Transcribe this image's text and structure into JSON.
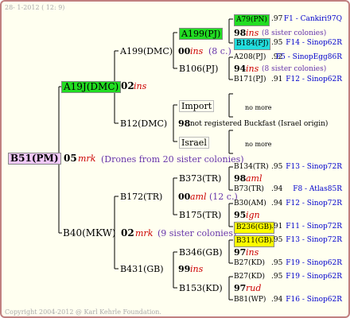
{
  "header": {
    "date": "28- 1-2012 ( 12: 9)"
  },
  "footer": {
    "copyright": "Copyright 2004-2012 @ Karl Kehrle Foundation."
  },
  "root": {
    "name": "B51(PM)",
    "num": "05",
    "tag": "mrk",
    "note": "(Drones from 20 sister colonies)"
  },
  "sire": {
    "name": "A19J(DMC)",
    "num": "02",
    "tag": "ins"
  },
  "dam": {
    "name": "B40(MKW)",
    "num": "02",
    "tag": "mrk",
    "note": "(9 sister colonies)"
  },
  "ss": {
    "name": "A199(DMC)",
    "num": "00",
    "tag": "ins",
    "note": "(8 c.)"
  },
  "sd": {
    "name": "B12(DMC)",
    "num": "98",
    "note": "not registered Buckfast (Israel origin)"
  },
  "ds": {
    "name": "B172(TR)",
    "num": "00",
    "tag": "aml",
    "note": "(12 c.)"
  },
  "dd": {
    "name": "B431(GB)",
    "num": "99",
    "tag": "ins"
  },
  "sss": {
    "name": "A199(PJ)",
    "num": "98",
    "tag": "ins",
    "note": "(8 sister colonies)"
  },
  "ssd": {
    "name": "B106(PJ)",
    "num": "94",
    "tag": "ins",
    "note": "(8 sister colonies)"
  },
  "sds": {
    "name": "Import",
    "note": "no more"
  },
  "sdd": {
    "name": "Israel",
    "note": "no more"
  },
  "dss": {
    "name": "B373(TR)",
    "num": "98",
    "tag": "aml"
  },
  "dsd": {
    "name": "B175(TR)",
    "num": "95",
    "tag": "ign"
  },
  "dds": {
    "name": "B346(GB)",
    "num": "97",
    "tag": "ins"
  },
  "ddd": {
    "name": "B153(KD)",
    "num": "97",
    "tag": "rud"
  },
  "g4": [
    {
      "name": "A79(PN)",
      "year": ".97",
      "ref": "F1 - Cankiri97Q"
    },
    {
      "name": "B184(PJ)",
      "year": ".95",
      "ref": "F14 - Sinop62R"
    },
    {
      "name": "A208(PJ)",
      "year": ".92",
      "ref": "F5 - SinopEgg86R"
    },
    {
      "name": "B171(PJ)",
      "year": ".91",
      "ref": "F12 - Sinop62R"
    },
    {
      "name": "B134(TR)",
      "year": ".95",
      "ref": "F13 - Sinop72R"
    },
    {
      "name": "B73(TR)",
      "year": ".94",
      "ref": "F8 - Atlas85R"
    },
    {
      "name": "B30(AM)",
      "year": ".94",
      "ref": "F12 - Sinop72R"
    },
    {
      "name": "B236(GB)",
      "year": ".91",
      "ref": "F11 - Sinop72R"
    },
    {
      "name": "B311(GB)",
      "year": ".95",
      "ref": "F13 - Sinop72R"
    },
    {
      "name": "B27(KD)",
      "year": ".95",
      "ref": "F19 - Sinop62R"
    },
    {
      "name": "B27(KD)",
      "year": ".95",
      "ref": "F19 - Sinop62R"
    },
    {
      "name": "B81(WP)",
      "year": ".94",
      "ref": "F16 - Sinop62R"
    }
  ]
}
